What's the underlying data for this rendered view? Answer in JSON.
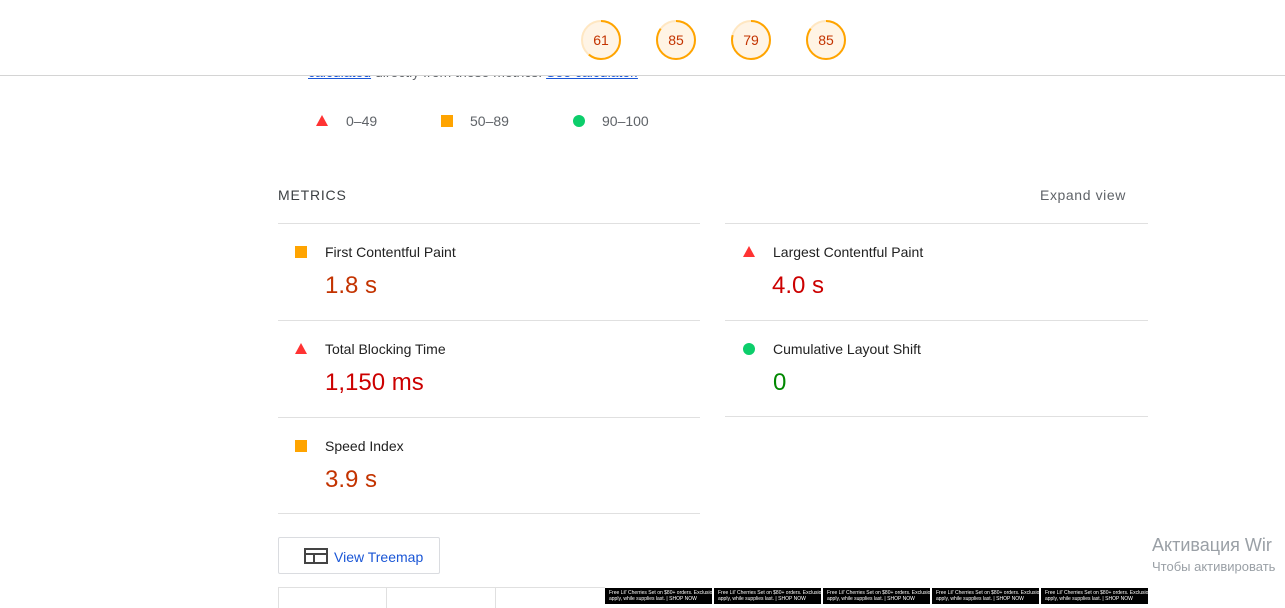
{
  "header": {
    "gauges": [
      {
        "score": "61",
        "value": 0.61
      },
      {
        "score": "85",
        "value": 0.85
      },
      {
        "score": "79",
        "value": 0.79
      },
      {
        "score": "85",
        "value": 0.85
      }
    ],
    "gauge_color": "#ffa400"
  },
  "intro": {
    "link_calculated": "calculated",
    "text_middle": "directly from these metrics.",
    "link_calculator": "See calculator."
  },
  "legend": [
    {
      "shape": "triangle",
      "range": "0–49",
      "color": "#ff3333"
    },
    {
      "shape": "square",
      "range": "50–89",
      "color": "#ffa400"
    },
    {
      "shape": "circle",
      "range": "90–100",
      "color": "#0cce6b"
    }
  ],
  "metrics": {
    "title": "METRICS",
    "expand_label": "Expand view",
    "items": [
      {
        "name": "First Contentful Paint",
        "value": "1.8 s",
        "status": "average"
      },
      {
        "name": "Largest Contentful Paint",
        "value": "4.0 s",
        "status": "fail"
      },
      {
        "name": "Total Blocking Time",
        "value": "1,150 ms",
        "status": "fail"
      },
      {
        "name": "Cumulative Layout Shift",
        "value": "0",
        "status": "pass"
      },
      {
        "name": "Speed Index",
        "value": "3.9 s",
        "status": "average"
      }
    ]
  },
  "treemap": {
    "label": "View Treemap"
  },
  "filmstrip": {
    "thumb_text_line1": "Free Lil' Cherries Set on $80+ orders. Exclusions",
    "thumb_text_line2": "apply, while supplies last. | SHOP NOW"
  },
  "watermark": {
    "line1": "Активация Wir",
    "line2": "Чтобы активировать"
  }
}
